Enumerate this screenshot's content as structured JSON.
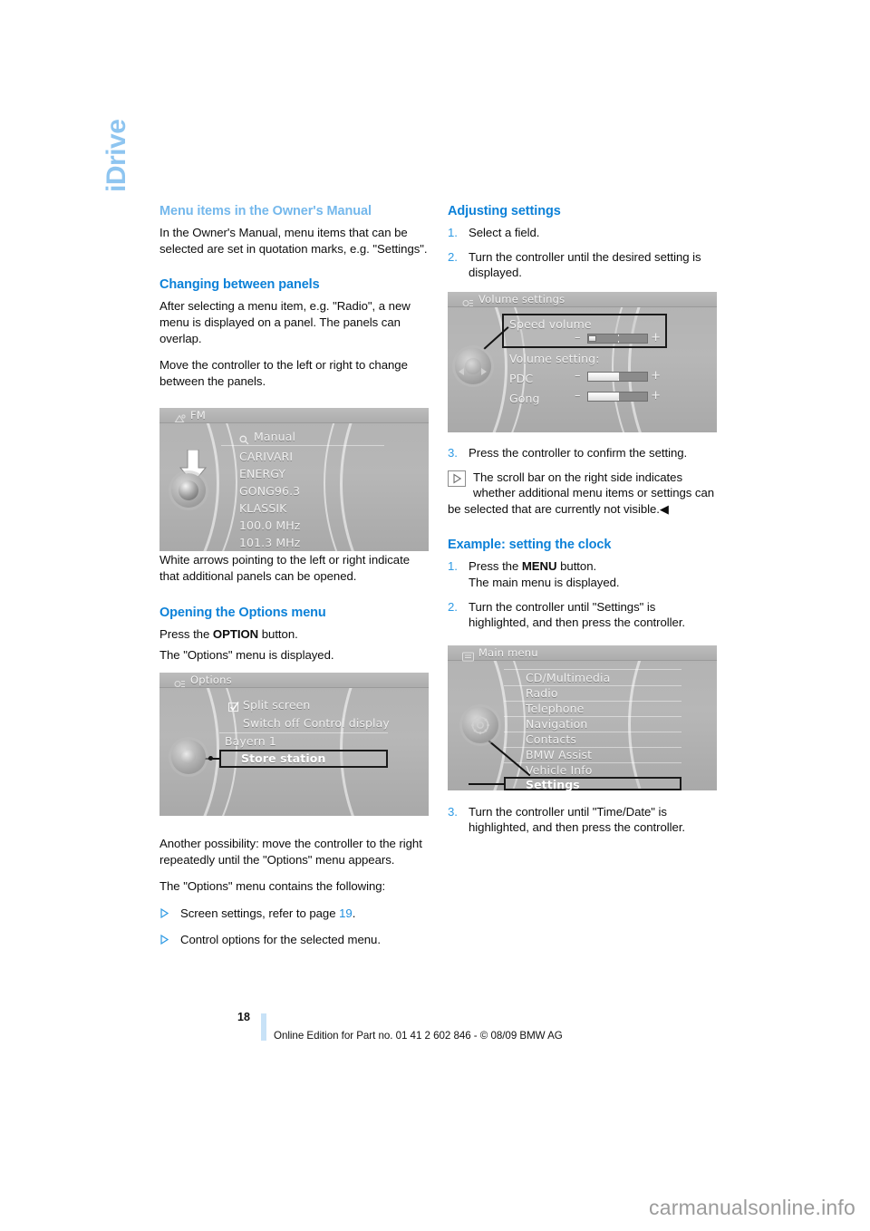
{
  "side_tab": {
    "label": "iDrive"
  },
  "left_column": {
    "heading_1": "Menu items in the Owner's Manual",
    "para_1": "In the Owner's Manual, menu items that can be selected are set in quotation marks, e.g. \"Settings\".",
    "heading_2": "Changing between panels",
    "para_2": "After selecting a menu item, e.g. \"Radio\", a new menu is displayed on a panel. The panels can overlap.",
    "para_3": "Move the controller to the left or right to change between the panels.",
    "para_4": "White arrows pointing to the left or right indicate that additional panels can be opened.",
    "heading_3": "Opening the Options menu",
    "para_5_a": "Press the ",
    "para_5_b": "OPTION",
    "para_5_c": " button.",
    "para_5_d": "The \"Options\" menu is displayed.",
    "para_6": "Another possibility: move the controller to the right repeatedly until the \"Options\" menu appears.",
    "para_7": "The \"Options\" menu contains the following:",
    "bullets": [
      {
        "text_before": "Screen settings, refer to page ",
        "pageref": "19",
        "text_after": "."
      },
      {
        "text_before": "Control options for the selected menu.",
        "pageref": "",
        "text_after": ""
      }
    ]
  },
  "right_column": {
    "heading_1": "Adjusting settings",
    "steps_1": [
      {
        "num": "1.",
        "text": "Select a field."
      },
      {
        "num": "2.",
        "text": "Turn the controller until the desired setting is displayed."
      }
    ],
    "steps_2": [
      {
        "num": "3.",
        "text": "Press the controller to confirm the setting."
      }
    ],
    "note_icon": "play-triangle-icon",
    "note_text": "The scroll bar on the right side indicates whether additional menu items or settings can be selected that are currently not visible.",
    "note_endmark": "◀",
    "heading_2": "Example: setting the clock",
    "steps_3": [
      {
        "num": "1.",
        "text_a": "Press the ",
        "text_b": "MENU",
        "text_c": " button.",
        "text_d": "The main menu is displayed."
      },
      {
        "num": "2.",
        "text": "Turn the controller until \"Settings\" is highlighted, and then press the controller."
      }
    ],
    "steps_4": [
      {
        "num": "3.",
        "text": "Turn the controller until \"Time/Date\" is highlighted, and then press the controller."
      }
    ]
  },
  "screenshots": {
    "fm_radio": {
      "title": "FM",
      "title_icon": "radio-tune-icon",
      "search_icon": "magnifier-icon",
      "items": [
        "Manual",
        "CARIVARI",
        "ENERGY",
        "GONG96.3",
        "KLASSIK",
        "100.0 MHz",
        "101.3 MHz"
      ],
      "arrow_icon": "white-down-arrow-icon",
      "controller_icon": "idrive-controller-knob"
    },
    "options": {
      "title": "Options",
      "title_icon": "options-icon",
      "checkbox_icon": "checked-box-icon",
      "items": [
        "Split screen",
        "Switch off Control display",
        "Bayern 1",
        "Store station"
      ],
      "highlighted_item": "Store station",
      "controller_icon": "idrive-controller-knob"
    },
    "volume_settings": {
      "title": "Volume settings",
      "title_icon": "settings-icon",
      "highlight_label": "Speed volume",
      "group_label": "Volume setting:",
      "sliders": [
        {
          "name": "Speed volume",
          "minus": "–",
          "plus": "+",
          "value_pct": 8
        },
        {
          "name": "PDC",
          "minus": "–",
          "plus": "+",
          "value_pct": 52
        },
        {
          "name": "Gong",
          "minus": "–",
          "plus": "+",
          "value_pct": 52
        }
      ],
      "controller_icon": "idrive-controller-knob"
    },
    "main_menu": {
      "title": "Main menu",
      "title_icon": "main-menu-icon",
      "items": [
        "CD/Multimedia",
        "Radio",
        "Telephone",
        "Navigation",
        "Contacts",
        "BMW Assist",
        "Vehicle Info",
        "Settings"
      ],
      "highlighted_item": "Settings",
      "controller_icon": "idrive-controller-gear-knob"
    }
  },
  "footer": {
    "page_number": "18",
    "text": "Online Edition for Part no. 01 41 2 602 846 - © 08/09 BMW AG"
  },
  "watermark": {
    "text": "carmanualsonline.info"
  },
  "colors": {
    "heading_blue": "#0c81d8",
    "heading_blue_pale": "#74b8ec",
    "step_number_blue": "#2e9ae4",
    "pageref_blue": "#1f8ede",
    "footer_bar": "#c8e2f7"
  }
}
